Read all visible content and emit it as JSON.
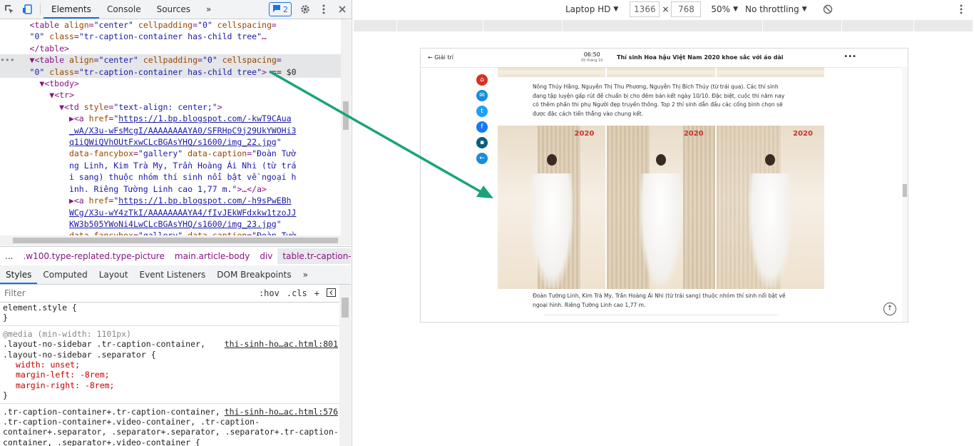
{
  "devtools": {
    "tabs": [
      "Elements",
      "Console",
      "Sources"
    ],
    "more_tabs": "»",
    "issues_count": "2",
    "dom_lines": [
      {
        "indent": "      ",
        "html": "<span class='tag'>&lt;table</span> <span class='attr'>align</span>=<span class='val'>\"center\"</span> <span class='attr'>cellpadding</span>=<span class='val'>\"0\"</span> <span class='attr'>cellspacing</span>="
      },
      {
        "indent": "      ",
        "html": "<span class='val'>\"0\"</span> <span class='attr'>class</span>=<span class='val'>\"tr-caption-container has-child tree\"</span>…"
      },
      {
        "indent": "      ",
        "html": "<span class='tag'>&lt;/table&gt;</span>"
      },
      {
        "indent": "•••   ",
        "html": "▼<span class='tag'>&lt;table</span> <span class='attr'>align</span>=<span class='val'>\"center\"</span> <span class='attr'>cellpadding</span>=<span class='val'>\"0\"</span> <span class='attr'>cellspacing</span>=",
        "sel": true
      },
      {
        "indent": "      ",
        "html": "<span class='val'>\"0\"</span> <span class='attr'>class</span>=<span class='val'>\"tr-caption-container has-child tree\"</span><span class='tag'>&gt;</span> <span class='txt'>== $0</span>",
        "sel": true
      },
      {
        "indent": "        ",
        "html": "▼<span class='tag'>&lt;tbody&gt;</span>"
      },
      {
        "indent": "          ",
        "html": "▼<span class='tag'>&lt;tr&gt;</span>"
      },
      {
        "indent": "            ",
        "html": "▼<span class='tag'>&lt;td</span> <span class='attr'>style</span>=<span class='val'>\"text-align: center;\"</span><span class='tag'>&gt;</span>"
      },
      {
        "indent": "              ",
        "html": "▶<span class='tag'>&lt;a</span> <span class='attr'>href</span>=<span class='val'>\"<span class='link'>https://1.bp.blogspot.com/-kwT9CAua</span></span>"
      },
      {
        "indent": "              ",
        "html": "<span class='link'>_wA/X3u-wFsMcgI/AAAAAAAAYA0/SFRHpC9j29UkYWOHi3</span>"
      },
      {
        "indent": "              ",
        "html": "<span class='link'>q1iQWiQVhOUtFxwCLcBGAsYHQ/s1600/img_22.jpg</span><span class='val'>\"</span>"
      },
      {
        "indent": "              ",
        "html": "<span class='attr'>data-fancybox</span>=<span class='val'>\"gallery\"</span> <span class='attr'>data-caption</span>=<span class='val'>\"Đoàn Tườ</span>"
      },
      {
        "indent": "              ",
        "html": "<span class='val'>ng Linh, Kim Trà My, Trần Hoàng Ái Nhi (từ trá</span>"
      },
      {
        "indent": "              ",
        "html": "<span class='val'>i sang) thuộc nhóm thí sinh nổi bật về ngoại h</span>"
      },
      {
        "indent": "              ",
        "html": "<span class='val'>ình. Riêng Tường Linh cao 1,77 m.\"</span><span class='tag'>&gt;</span>…<span class='tag'>&lt;/a&gt;</span>"
      },
      {
        "indent": "              ",
        "html": "▶<span class='tag'>&lt;a</span> <span class='attr'>href</span>=<span class='val'>\"<span class='link'>https://1.bp.blogspot.com/-h9sPwEBh</span></span>"
      },
      {
        "indent": "              ",
        "html": "<span class='link'>WCg/X3u-wY4zTkI/AAAAAAAAYA4/fIvJEkWFdxkw1tzoJJ</span>"
      },
      {
        "indent": "              ",
        "html": "<span class='link'>KW3b505YWoNi4LwCLcBGAsYHQ/s1600/img_23.jpg</span><span class='val'>\"</span>"
      },
      {
        "indent": "              ",
        "html": "<span class='attr'>data-fancybox</span>=<span class='val'>\"gallery\"</span> <span class='attr'>data-caption</span>=<span class='val'>\"Đoàn Tườ</span>"
      }
    ],
    "breadcrumbs": [
      "...",
      ".w100.type-replated.type-picture",
      "main.article-body",
      "div",
      "table.tr-caption-conta"
    ],
    "style_tabs": [
      "Styles",
      "Computed",
      "Layout",
      "Event Listeners",
      "DOM Breakpoints"
    ],
    "filter_placeholder": "Filter",
    "filter_hov": ":hov",
    "filter_cls": ".cls",
    "styles": {
      "element_style_open": "element.style {",
      "close": "}",
      "media": "@media (min-width: 1101px)",
      "rule1_sel1": ".layout-no-sidebar .tr-caption-container,",
      "rule1_sel2": ".layout-no-sidebar .separator {",
      "rule1_src": "thi-sinh-ho…ac.html:801",
      "rule1_props": [
        "width: unset;",
        "margin-left: -8rem;",
        "margin-right: -8rem;"
      ],
      "rule2_sel": [
        ".tr-caption-container+.tr-caption-container,",
        ".tr-caption-container+.video-container, .tr-caption-",
        "container+.separator, .separator+.separator, .separator+.tr-caption-",
        "container, .separator+.video-container {"
      ],
      "rule2_src": "thi-sinh-ho…ac.html:576"
    }
  },
  "device_toolbar": {
    "device": "Laptop HD",
    "width": "1366",
    "times": "×",
    "height": "768",
    "zoom": "50%",
    "throttle": "No throttling"
  },
  "page": {
    "back_label": "← Giải trí",
    "time": "06:50",
    "date": "05 tháng 10",
    "title": "Thí sinh Hoa hậu Việt Nam 2020 khoe sắc với áo dài",
    "more": "•••",
    "para1": "Nông Thúy Hằng, Nguyễn Thị Thu Phương, Nguyễn Thị Bích Thủy (từ trái qua). Các thí sinh đang tập luyện gấp rút để chuẩn bị cho đêm bán kết ngày 10/10. Đặc biệt, cuộc thi năm nay có thêm phần thi phụ Người đẹp truyền thông. Top 2 thí sinh dẫn đầu các cổng bình chọn sẽ được đặc cách tiến thẳng vào chung kết.",
    "caption": "Đoàn Tường Linh, Kim Trà My, Trần Hoàng Ái Nhi (từ trái sang) thuộc nhóm thí sinh nổi bật về ngoại hình. Riêng Tường Linh cao 1,77 m.",
    "photo_logo": "2020",
    "social_colors": [
      "#d93025",
      "#1a8cd8",
      "#1da1f2",
      "#1877f2",
      "#0b5f7a",
      "#1a8cd8"
    ]
  },
  "colors": {
    "arrow": "#1aa37a",
    "accent": "#1a73e8"
  }
}
